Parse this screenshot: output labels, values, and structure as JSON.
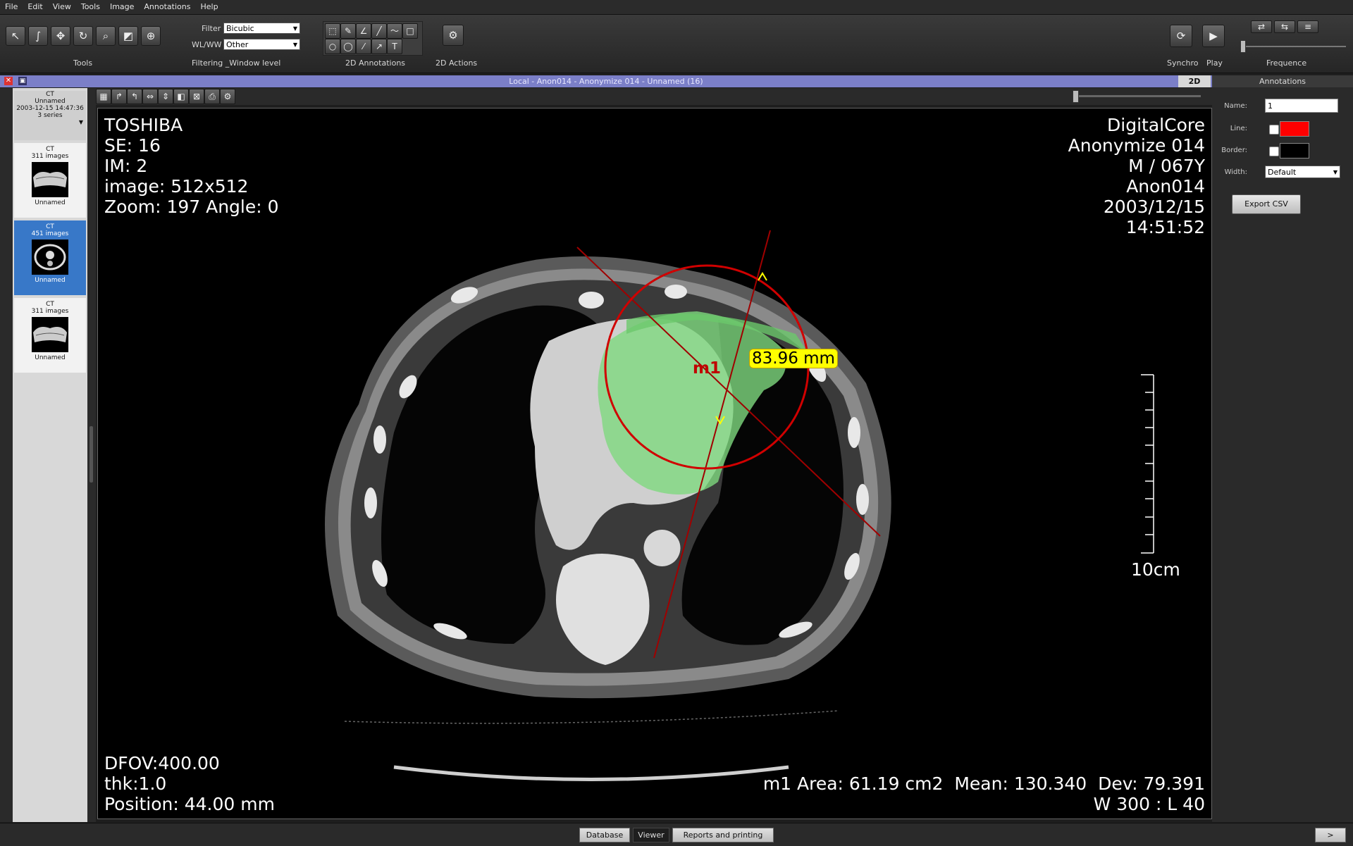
{
  "menu": [
    "File",
    "Edit",
    "View",
    "Tools",
    "Image",
    "Annotations",
    "Help"
  ],
  "toolbar": {
    "tools_label": "Tools",
    "filter_label": "Filter",
    "filter_value": "Bicubic",
    "wlww_label": "WL/WW",
    "wlww_value": "Other",
    "filtering_label": "Filtering _Window level",
    "annotations_label": "2D Annotations",
    "actions_label": "2D Actions",
    "synchro_label": "Synchro",
    "play_label": "Play",
    "frequence_label": "Frequence"
  },
  "titlebar": {
    "text": "Local - Anon014 - Anonymize 014 - Unnamed (16)",
    "mode": "2D"
  },
  "study": {
    "modality": "CT",
    "name": "Unnamed",
    "date": "2003-12-15 14:47:36",
    "series_count": "3 series"
  },
  "series": [
    {
      "modality": "CT",
      "images": "311 images",
      "name": "Unnamed"
    },
    {
      "modality": "CT",
      "images": "451 images",
      "name": "Unnamed"
    },
    {
      "modality": "CT",
      "images": "311 images",
      "name": "Unnamed"
    }
  ],
  "overlay": {
    "tl": [
      "TOSHIBA",
      "SE: 16",
      "IM: 2",
      "image: 512x512",
      "Zoom: 197 Angle: 0"
    ],
    "tr": [
      "DigitalCore",
      "Anonymize 014",
      "M / 067Y",
      "Anon014",
      "2003/12/15",
      "14:51:52"
    ],
    "bl": [
      "DFOV:400.00",
      "thk:1.0",
      "Position: 44.00 mm"
    ],
    "br": [
      "m1 Area: 61.19 cm2  Mean: 130.340  Dev: 79.391",
      "W 300 : L 40"
    ],
    "scale": "10cm",
    "roi_name": "m1",
    "measure": "83.96 mm"
  },
  "annotations_panel": {
    "title": "Annotations",
    "name_label": "Name:",
    "name_value": "1",
    "line_label": "Line:",
    "line_color": "#ff0000",
    "border_label": "Border:",
    "border_color": "#000000",
    "width_label": "Width:",
    "width_value": "Default",
    "export_label": "Export CSV"
  },
  "bottom_tabs": {
    "database": "Database",
    "viewer": "Viewer",
    "reports": "Reports and printing",
    "next": ">"
  }
}
